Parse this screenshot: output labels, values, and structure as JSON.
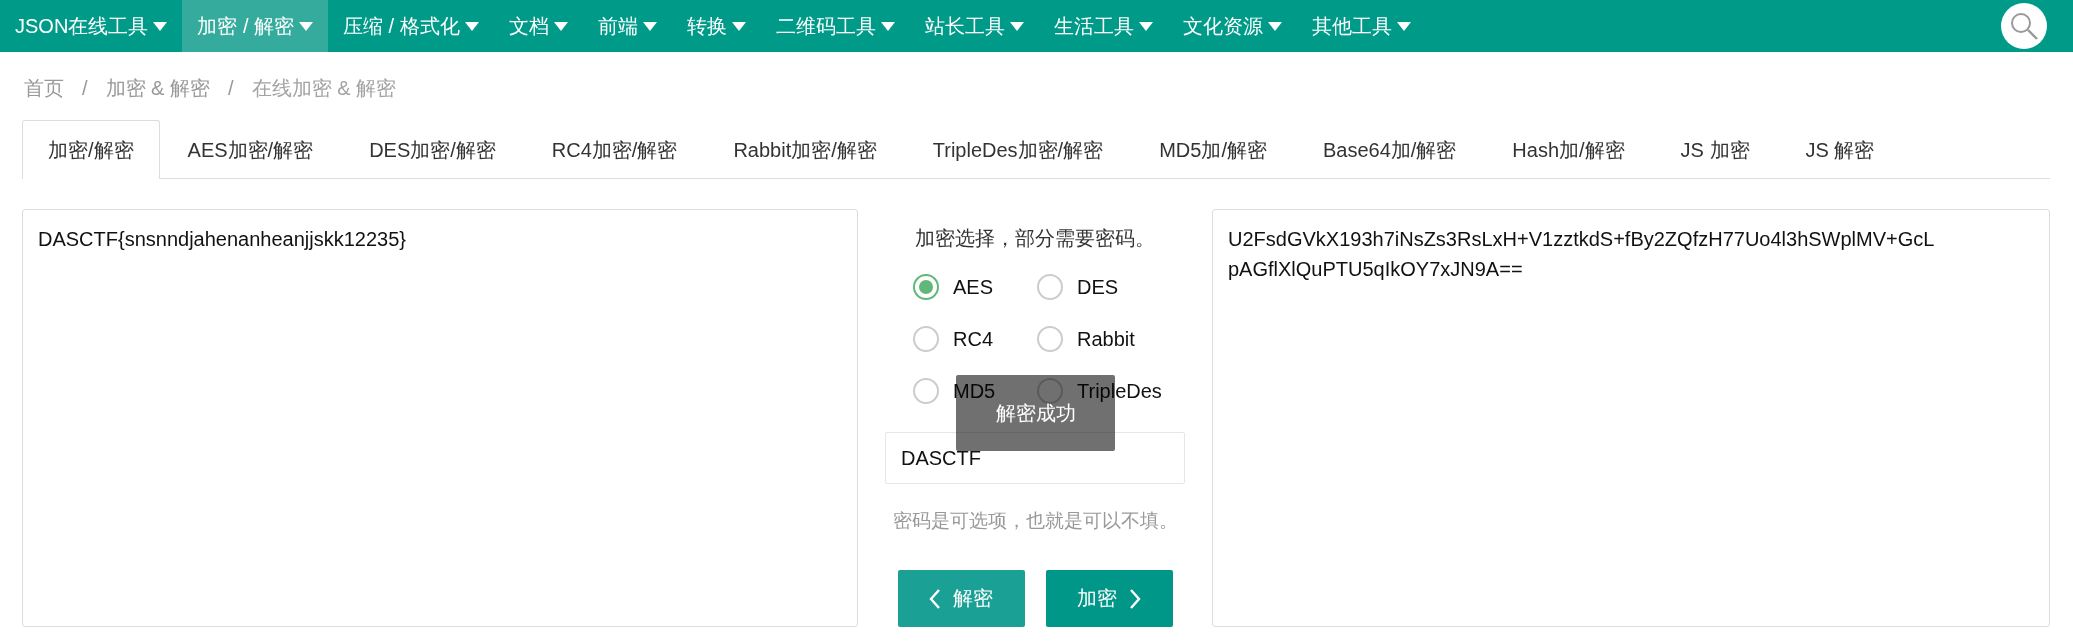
{
  "nav": {
    "items": [
      {
        "label": "JSON在线工具",
        "selected": false
      },
      {
        "label": "加密 / 解密",
        "selected": true
      },
      {
        "label": "压缩 / 格式化",
        "selected": false
      },
      {
        "label": "文档",
        "selected": false
      },
      {
        "label": "前端",
        "selected": false
      },
      {
        "label": "转换",
        "selected": false
      },
      {
        "label": "二维码工具",
        "selected": false
      },
      {
        "label": "站长工具",
        "selected": false
      },
      {
        "label": "生活工具",
        "selected": false
      },
      {
        "label": "文化资源",
        "selected": false
      },
      {
        "label": "其他工具",
        "selected": false
      }
    ]
  },
  "breadcrumb": [
    {
      "kind": "link",
      "text": "首页"
    },
    {
      "kind": "separator",
      "text": "/"
    },
    {
      "kind": "link",
      "text": "加密 & 解密"
    },
    {
      "kind": "separator",
      "text": "/"
    },
    {
      "kind": "current",
      "text": "在线加密 & 解密"
    }
  ],
  "tabs": [
    {
      "label": "加密/解密",
      "selected": true
    },
    {
      "label": "AES加密/解密",
      "selected": false
    },
    {
      "label": "DES加密/解密",
      "selected": false
    },
    {
      "label": "RC4加密/解密",
      "selected": false
    },
    {
      "label": "Rabbit加密/解密",
      "selected": false
    },
    {
      "label": "TripleDes加密/解密",
      "selected": false
    },
    {
      "label": "MD5加/解密",
      "selected": false
    },
    {
      "label": "Base64加/解密",
      "selected": false
    },
    {
      "label": "Hash加/解密",
      "selected": false
    },
    {
      "label": "JS 加密",
      "selected": false
    },
    {
      "label": "JS 解密",
      "selected": false
    }
  ],
  "input": {
    "value": "DASCTF{snsnndjahenanheanjjskk12235}"
  },
  "options": {
    "title": "加密选择，部分需要密码。",
    "algorithms": [
      {
        "label": "AES",
        "selected": true
      },
      {
        "label": "DES",
        "selected": false
      },
      {
        "label": "RC4",
        "selected": false
      },
      {
        "label": "Rabbit",
        "selected": false
      },
      {
        "label": "MD5",
        "selected": false
      },
      {
        "label": "TripleDes",
        "selected": false
      }
    ]
  },
  "password": {
    "value": "DASCTF"
  },
  "hint": "密码是可选项，也就是可以不填。",
  "buttons": [
    {
      "label": "解密",
      "kind": "prev"
    },
    {
      "label": "加密",
      "kind": "next"
    }
  ],
  "output": {
    "value": "U2FsdGVkX193h7iNsZs3RsLxH+V1zztkdS+fBy2ZQfzH77Uo4l3hSWplMV+GcLpAGflXlQuPTU5qIkOY7xJN9A=="
  },
  "toast": {
    "text": "解密成功"
  }
}
